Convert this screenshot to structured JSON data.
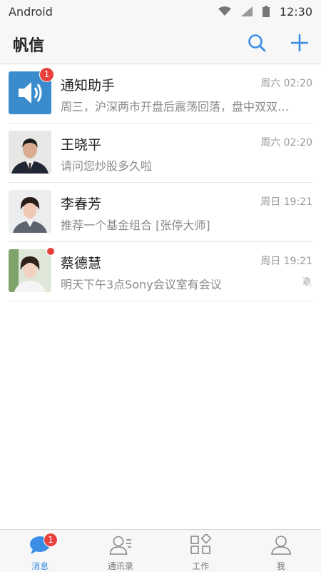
{
  "status_bar": {
    "carrier": "Android",
    "time": "12:30",
    "icons": [
      "wifi-icon",
      "signal-icon",
      "battery-icon"
    ]
  },
  "header": {
    "title": "帆信",
    "icons": [
      "search-icon",
      "plus-icon"
    ]
  },
  "accent_color": "#3a8ee6",
  "badge_color": "#e8403a",
  "conversations": [
    {
      "name": "通知助手",
      "time": "周六 02:20",
      "preview": "周三，沪深两市开盘后震荡回落，盘中双双…",
      "badge": "1",
      "avatar": "speaker-icon"
    },
    {
      "name": "王晓平",
      "time": "周六 02:20",
      "preview": "请问您炒股多久啦",
      "avatar": "male-avatar"
    },
    {
      "name": "李春芳",
      "time": "周日 19:21",
      "preview": "推荐一个基金组合 [张停大师]",
      "avatar": "female-avatar"
    },
    {
      "name": "蔡德慧",
      "time": "周日 19:21",
      "preview": "明天下午3点Sony会议室有会议",
      "unread_dot": true,
      "muted": true,
      "avatar": "female-avatar-2"
    }
  ],
  "tabs": [
    {
      "label": "消息",
      "icon": "chat-bubble-icon",
      "active": true,
      "badge": "1"
    },
    {
      "label": "通讯录",
      "icon": "contacts-icon",
      "active": false
    },
    {
      "label": "工作",
      "icon": "apps-grid-icon",
      "active": false
    },
    {
      "label": "我",
      "icon": "person-icon",
      "active": false
    }
  ]
}
